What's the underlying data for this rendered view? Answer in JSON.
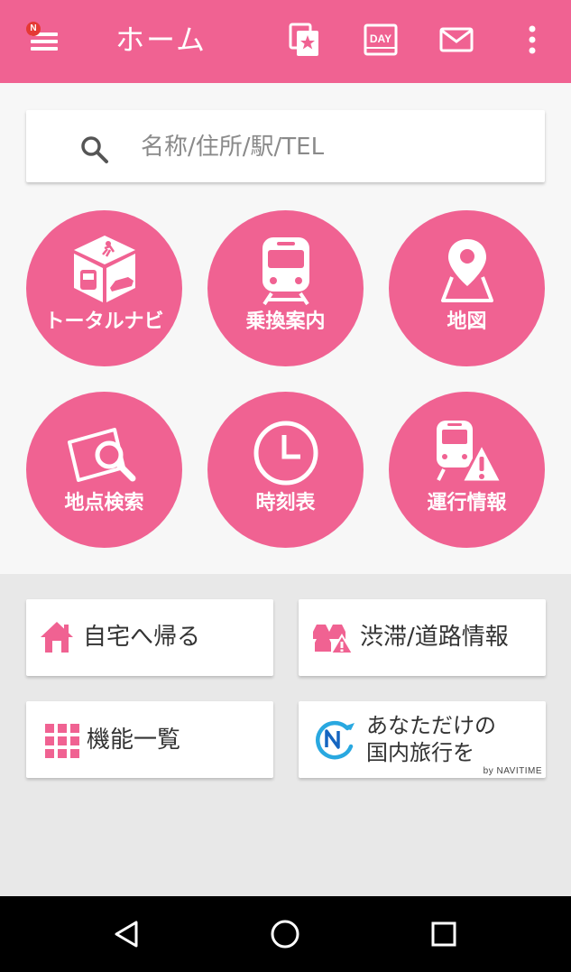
{
  "appbar": {
    "title": "ホーム",
    "badge": "N",
    "actions": [
      {
        "icon": "favorite-star-icon"
      },
      {
        "icon": "day-calendar-icon",
        "text": "DAY"
      },
      {
        "icon": "mail-icon"
      },
      {
        "icon": "more-vert-icon"
      }
    ]
  },
  "search": {
    "placeholder": "名称/住所/駅/TEL",
    "icon": "search-icon"
  },
  "features": [
    {
      "label": "トータルナビ",
      "icon": "total-navi-cube-icon"
    },
    {
      "label": "乗換案内",
      "icon": "train-icon"
    },
    {
      "label": "地図",
      "icon": "map-pin-icon"
    },
    {
      "label": "地点検索",
      "icon": "point-search-icon"
    },
    {
      "label": "時刻表",
      "icon": "clock-icon"
    },
    {
      "label": "運行情報",
      "icon": "train-warning-icon"
    }
  ],
  "cards": [
    {
      "label": "自宅へ帰る",
      "icon": "home-icon"
    },
    {
      "label": "渋滞/道路情報",
      "icon": "traffic-icon"
    },
    {
      "label": "機能一覧",
      "icon": "grid-icon"
    },
    {
      "line1": "あなただけの",
      "line2": "国内旅行を",
      "byline": "by NAVITIME",
      "icon": "navitime-travel-logo-icon"
    }
  ],
  "colors": {
    "primary": "#f06292",
    "background": "#e8e8e8",
    "panel": "#f7f7f7"
  }
}
